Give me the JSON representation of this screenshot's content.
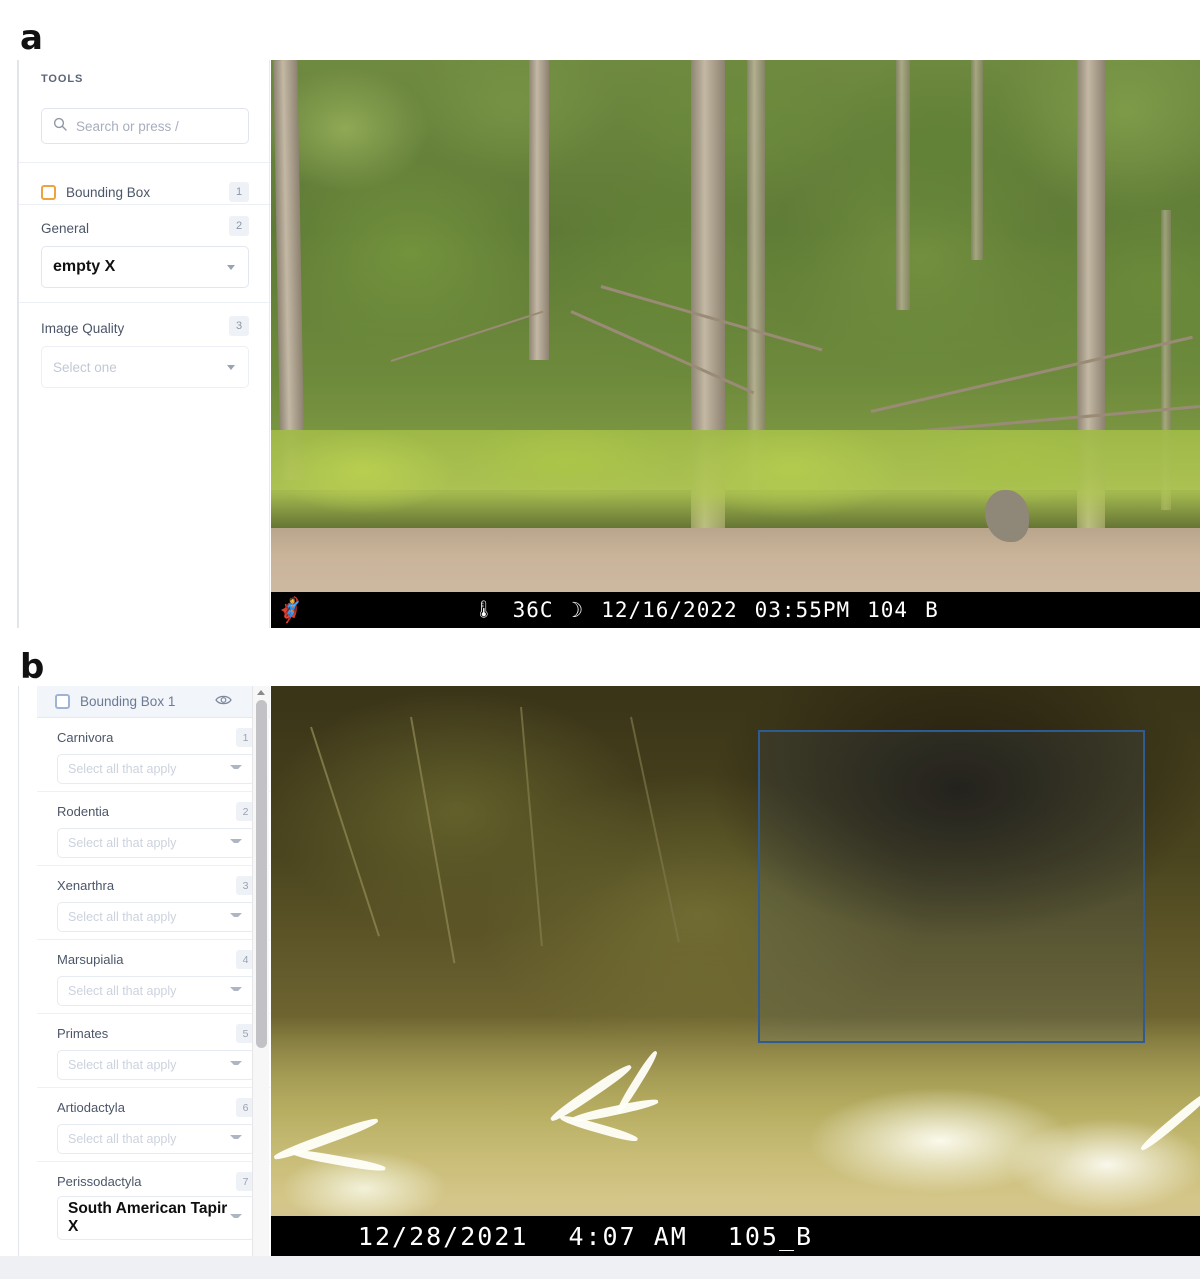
{
  "figure": {
    "panel_a_letter": "a",
    "panel_b_letter": "b"
  },
  "panel_a": {
    "sidebar": {
      "section_label": "TOOLS",
      "search": {
        "placeholder": "Search or press /",
        "icon": "search-icon"
      },
      "rows": [
        {
          "label": "Bounding Box",
          "shortcut": "1",
          "icon": "bounding-box-icon"
        },
        {
          "label": "General",
          "shortcut": "2"
        },
        {
          "label": "Image Quality",
          "shortcut": "3"
        }
      ],
      "general_select": {
        "value": "empty",
        "remove": "X"
      },
      "image_quality_select": {
        "placeholder": "Select one"
      }
    },
    "image": {
      "alt": "daytime camera trap photo of empty forest edge",
      "data_strip": {
        "brand_icon": "browning-logo-icon",
        "thermometer_icon": "thermometer-icon",
        "temperature": "36C",
        "moon_icon": "moon-phase-icon",
        "date": "12/16/2022",
        "time": "03:55PM",
        "sequence": "104",
        "camera": "B"
      }
    }
  },
  "panel_b": {
    "sidebar": {
      "header": {
        "title": "Bounding Box 1",
        "checkbox_icon": "bounding-box-icon",
        "visibility_icon": "eye-icon",
        "menu_icon": "kebab-menu-icon"
      },
      "groups": [
        {
          "label": "Carnivora",
          "shortcut": "1",
          "placeholder": "Select all that apply",
          "value": null
        },
        {
          "label": "Rodentia",
          "shortcut": "2",
          "placeholder": "Select all that apply",
          "value": null
        },
        {
          "label": "Xenarthra",
          "shortcut": "3",
          "placeholder": "Select all that apply",
          "value": null
        },
        {
          "label": "Marsupialia",
          "shortcut": "4",
          "placeholder": "Select all that apply",
          "value": null
        },
        {
          "label": "Primates",
          "shortcut": "5",
          "placeholder": "Select all that apply",
          "value": null
        },
        {
          "label": "Artiodactyla",
          "shortcut": "6",
          "placeholder": "Select all that apply",
          "value": null
        },
        {
          "label": "Perissodactyla",
          "shortcut": "7",
          "placeholder": "Select all that apply",
          "value": "South American Tapir",
          "remove": "X"
        }
      ]
    },
    "image": {
      "alt": "nighttime camera trap photo of a South American Tapir with bounding box annotation",
      "annotation": {
        "label": "bounding-box-1",
        "color": "#2f5b93"
      },
      "data_strip": {
        "date": "12/28/2021",
        "time": "4:07 AM",
        "sequence": "105_B"
      }
    }
  },
  "colors": {
    "bounding_box_tool": "#f0a23c",
    "annotation_box": "#2f5b93",
    "shortcut_chip_bg": "#eef1f6",
    "panel_header_bg": "#f2f5f9"
  }
}
